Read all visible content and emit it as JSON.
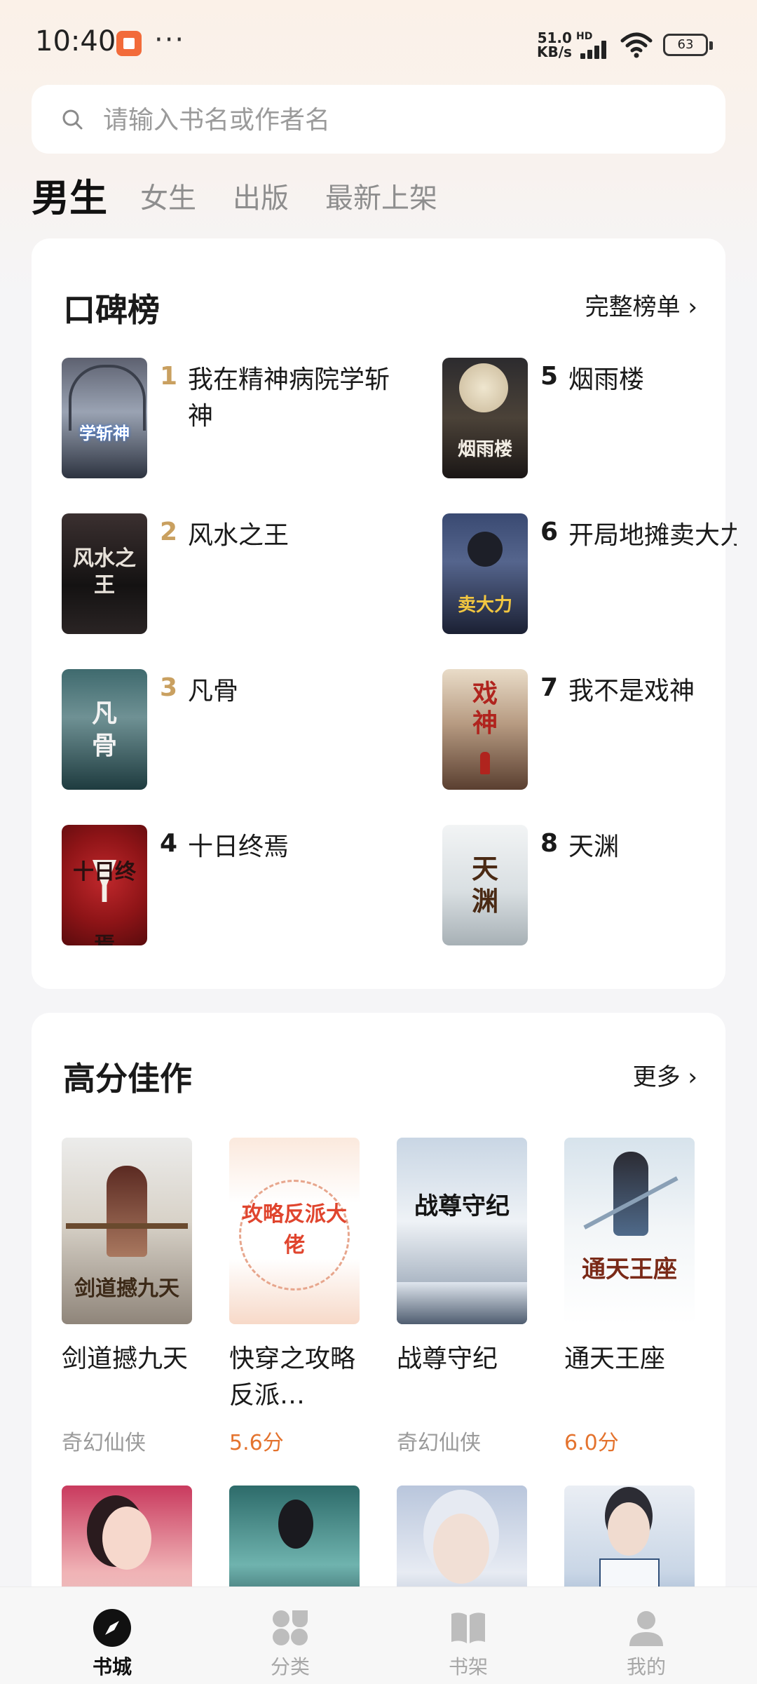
{
  "status_bar": {
    "time": "10:40",
    "more": "···",
    "net_speed_value": "51.0",
    "net_speed_unit": "KB/s",
    "network_type": "HD",
    "battery": "63"
  },
  "search": {
    "placeholder": "请输入书名或作者名"
  },
  "tabs": [
    "男生",
    "女生",
    "出版",
    "最新上架"
  ],
  "ranking": {
    "title": "口碑榜",
    "more_label": "完整榜单 ›",
    "items": [
      {
        "rank": "1",
        "title": "我在精神病院学斩神",
        "cover_text": "学斩神"
      },
      {
        "rank": "2",
        "title": "风水之王",
        "cover_text": "风水之王"
      },
      {
        "rank": "3",
        "title": "凡骨",
        "cover_text": "凡骨"
      },
      {
        "rank": "4",
        "title": "十日终焉",
        "cover_text": "十日终焉"
      },
      {
        "rank": "5",
        "title": "烟雨楼",
        "cover_text": "烟雨楼"
      },
      {
        "rank": "6",
        "title": "开局地摊卖大力",
        "cover_text": "卖大力"
      },
      {
        "rank": "7",
        "title": "我不是戏神",
        "cover_text": "戏神"
      },
      {
        "rank": "8",
        "title": "天渊",
        "cover_text": "天渊"
      }
    ]
  },
  "high_score": {
    "title": "高分佳作",
    "more_label": "更多 ›",
    "books": [
      {
        "title": "剑道撼九天",
        "meta": "奇幻仙侠",
        "meta_type": "genre",
        "cover_text": "剑道撼九天"
      },
      {
        "title": "快穿之攻略反派…",
        "meta": "5.6分",
        "meta_type": "score",
        "cover_text": "攻略反派大佬"
      },
      {
        "title": "战尊守纪",
        "meta": "奇幻仙侠",
        "meta_type": "genre",
        "cover_text": "战尊守纪"
      },
      {
        "title": "通天王座",
        "meta": "6.0分",
        "meta_type": "score",
        "cover_text": "通天王座"
      }
    ]
  },
  "bottom_nav": [
    {
      "label": "书城",
      "icon": "compass-icon",
      "active": true
    },
    {
      "label": "分类",
      "icon": "grid-icon",
      "active": false
    },
    {
      "label": "书架",
      "icon": "book-icon",
      "active": false
    },
    {
      "label": "我的",
      "icon": "person-icon",
      "active": false
    }
  ],
  "colors": {
    "rank_top3": "#c9a060",
    "rank_rest": "#1a1a1a",
    "score": "#e4732e",
    "genre": "#9a9a9a"
  }
}
